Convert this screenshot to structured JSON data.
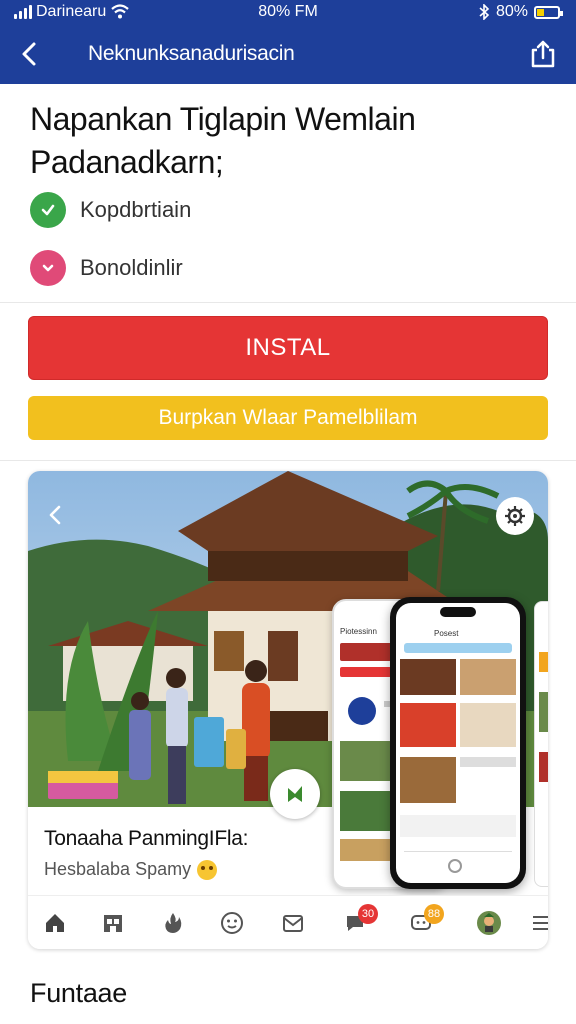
{
  "status_bar": {
    "carrier": "Darinearu",
    "time": "80% FM",
    "battery": "80%",
    "icons": [
      "signal-icon",
      "wifi-icon",
      "bluetooth-icon",
      "battery-icon"
    ]
  },
  "header": {
    "title": "Neknunksanadurisacin",
    "back_icon": "chevron-left-icon",
    "share_icon": "share-icon"
  },
  "app": {
    "title": "Napankan Tiglapin Wemlain Padanadkarn;",
    "features": [
      {
        "label": "Kopdbrtiain",
        "icon": "check-icon",
        "color": "#3aa64a"
      },
      {
        "label": "Bonoldinlir",
        "icon": "chevron-down-icon",
        "color": "#e04a78"
      }
    ]
  },
  "actions": {
    "install_label": "INSTAL",
    "secondary_label": "Burpkan Wlaar Pamelblilam",
    "install_color": "#e53535",
    "secondary_color": "#f2c01e"
  },
  "promo": {
    "title": "Tonaaha PanmingIFla:",
    "subtitle": "Hesbalaba Spamy",
    "phone_back_title": "Piotessinn",
    "phone_front_title": "Posest",
    "nav": {
      "items": [
        "home-icon",
        "store-icon",
        "fire-icon",
        "smile-icon",
        "inbox-icon",
        "chat-icon",
        "message-icon",
        "avatar",
        "menu-icon"
      ],
      "badges": [
        {
          "value": "30",
          "color": "#e53535"
        },
        {
          "value": "88",
          "color": "#f2a51e"
        }
      ]
    }
  },
  "section": {
    "title": "Funtaae"
  },
  "colors": {
    "primary": "#1e3f9a",
    "background": "#ffffff"
  }
}
